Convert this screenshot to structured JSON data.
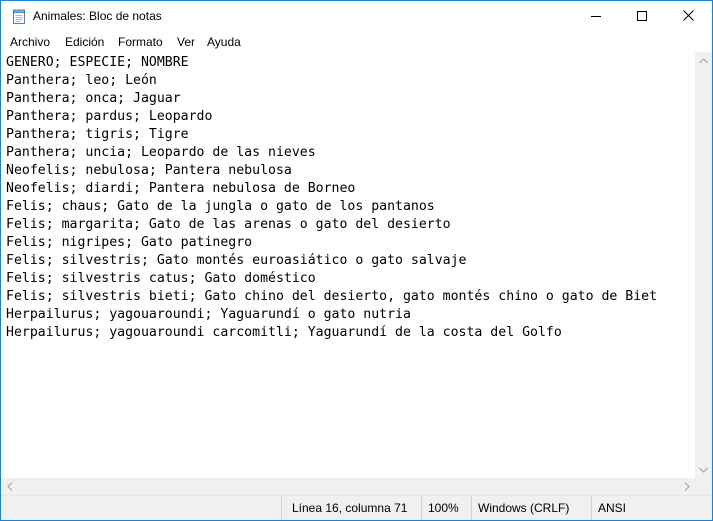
{
  "window": {
    "title": "Animales: Bloc de notas"
  },
  "icons": {
    "app": "notepad-icon",
    "minimize": "minimize-icon",
    "maximize": "maximize-icon",
    "close": "close-icon"
  },
  "menu": {
    "items": [
      "Archivo",
      "Edición",
      "Formato",
      "Ver",
      "Ayuda"
    ]
  },
  "document": {
    "lines": [
      "GENERO; ESPECIE; NOMBRE",
      "Panthera; leo; León",
      "Panthera; onca; Jaguar",
      "Panthera; pardus; Leopardo",
      "Panthera; tigris; Tigre",
      "Panthera; uncia; Leopardo de las nieves",
      "Neofelis; nebulosa; Pantera nebulosa",
      "Neofelis; diardi; Pantera nebulosa de Borneo",
      "Felis; chaus; Gato de la jungla o gato de los pantanos",
      "Felis; margarita; Gato de las arenas o gato del desierto",
      "Felis; nigripes; Gato patinegro",
      "Felis; silvestris; Gato montés euroasiático o gato salvaje",
      "Felis; silvestris catus; Gato doméstico",
      "Felis; silvestris bieti; Gato chino del desierto, gato montés chino o gato de Biet",
      "Herpailurus; yagouaroundi; Yaguarundí o gato nutria",
      "Herpailurus; yagouaroundi carcomitli; Yaguarundí de la costa del Golfo"
    ]
  },
  "status": {
    "position": "Línea 16, columna 71",
    "zoom": "100%",
    "line_ending": "Windows (CRLF)",
    "encoding": "ANSI"
  },
  "colors": {
    "window_border": "#1883d7",
    "statusbar": "#f0f0f0",
    "scrollbar": "#f0f0f0"
  }
}
